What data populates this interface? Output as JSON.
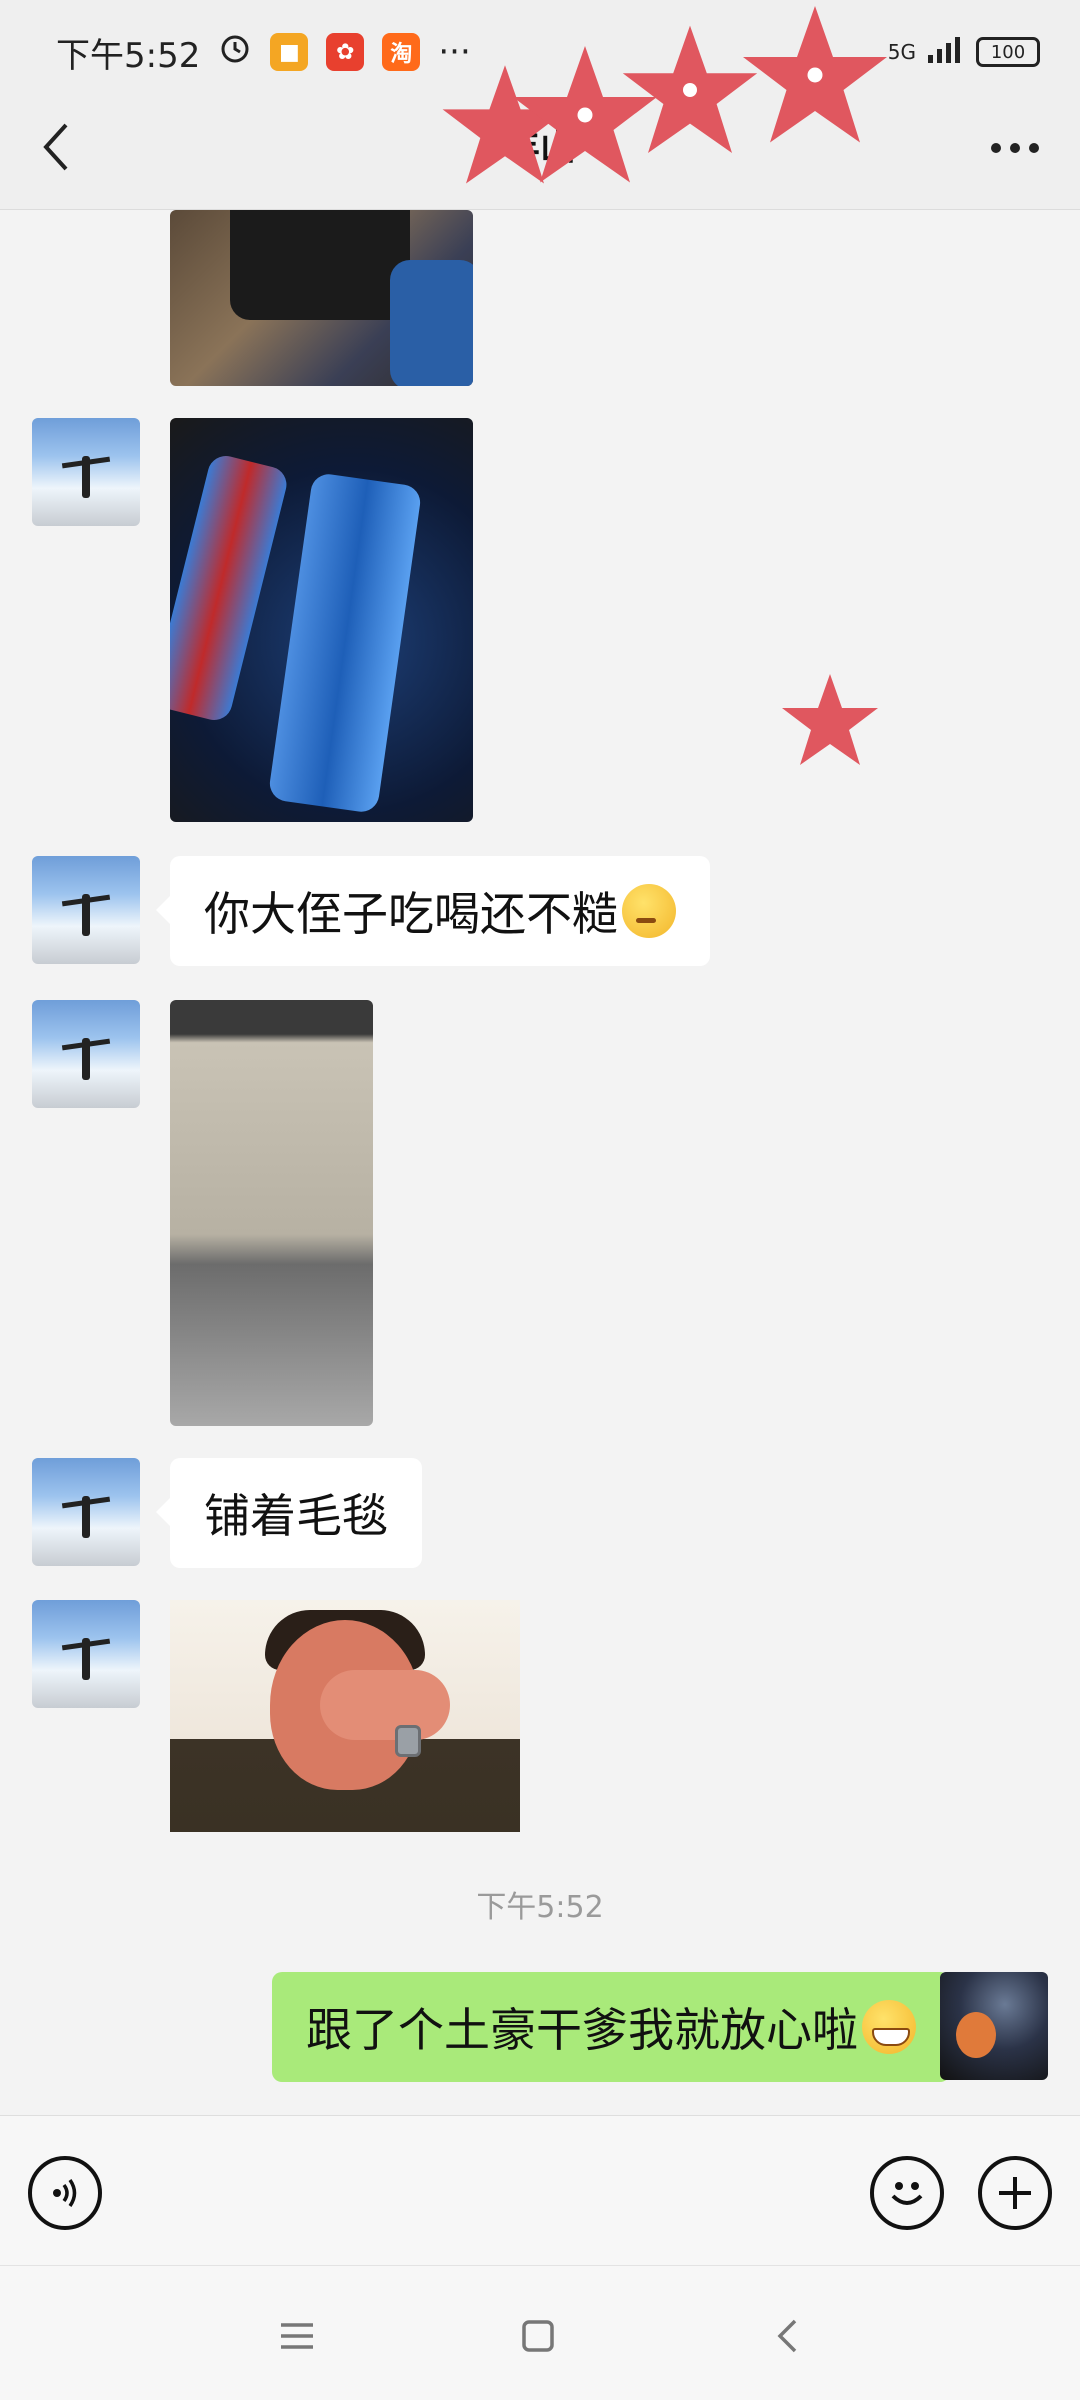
{
  "status_bar": {
    "time": "下午5:52",
    "app_icons": [
      "alarm-icon",
      "notes-app-icon",
      "pinduoduo-app-icon",
      "taobao-app-icon"
    ],
    "more": "···",
    "network": "5G",
    "battery": "100"
  },
  "header": {
    "title": "丰山"
  },
  "messages": {
    "m3_text": "你大侄子吃喝还不糙",
    "m5_text": "铺着毛毯",
    "timestamp": "下午5:52",
    "m7_text": "跟了个土豪干爹我就放心啦"
  },
  "colors": {
    "background": "#f3f3f3",
    "bubble_left": "#ffffff",
    "bubble_right": "#a9ea7a",
    "star": "#e0575f"
  }
}
